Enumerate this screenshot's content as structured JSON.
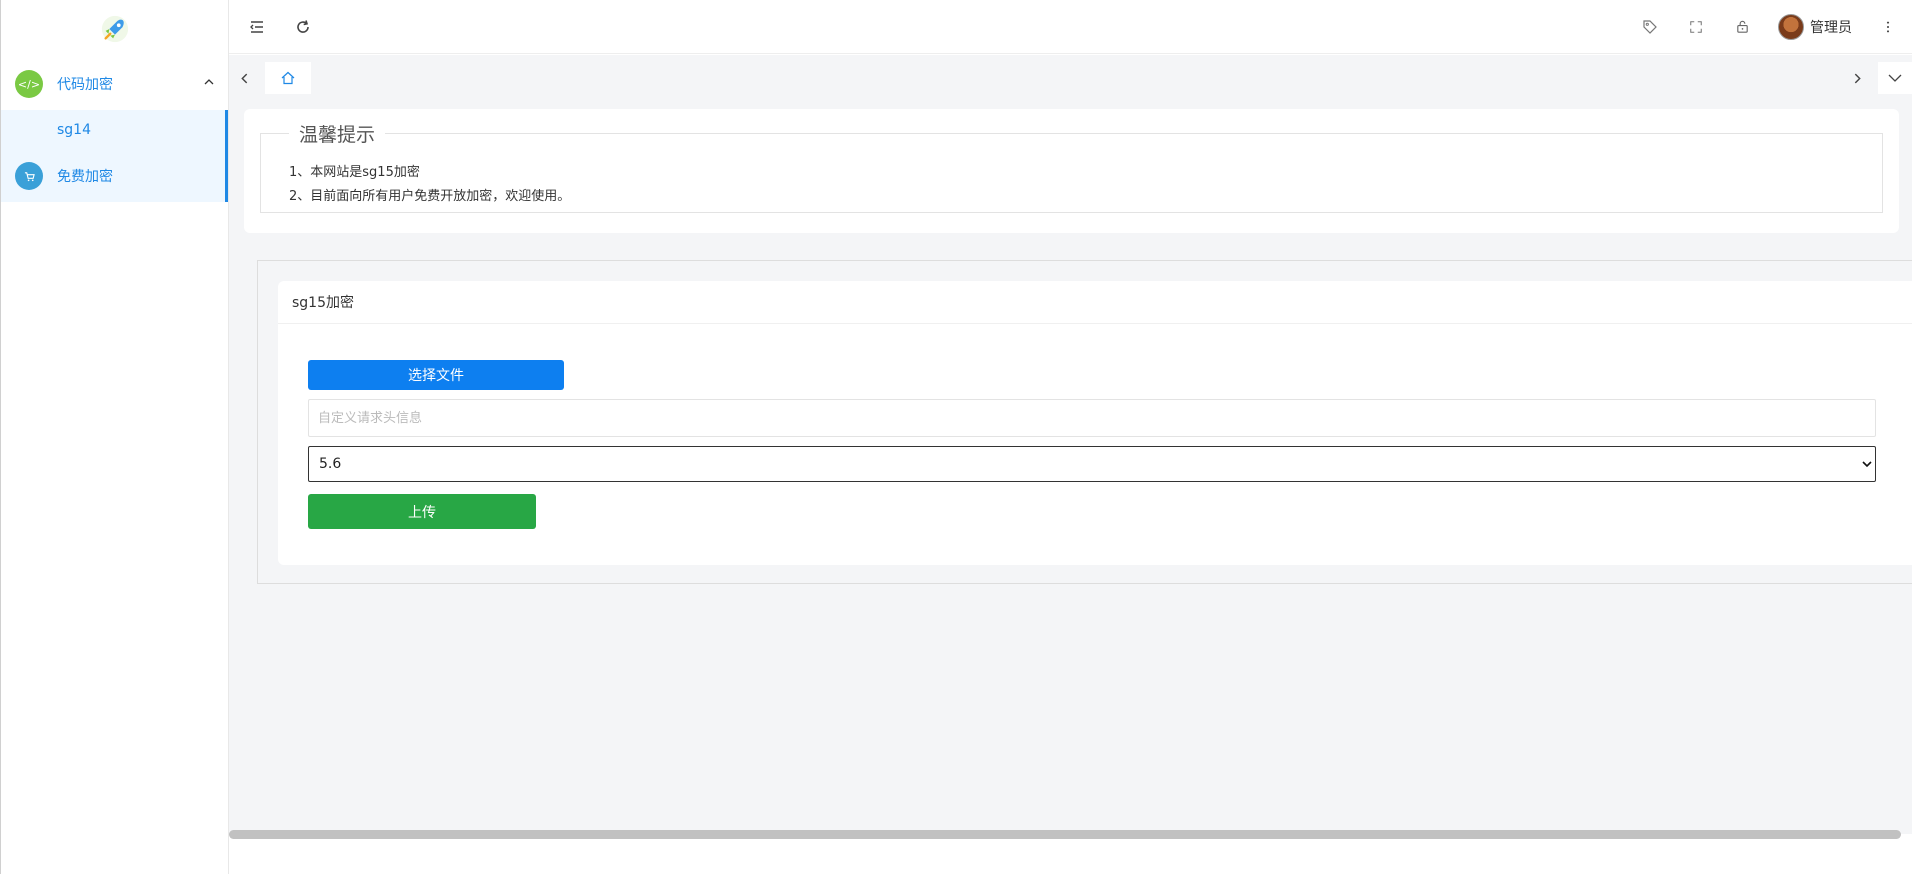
{
  "sidebar": {
    "items": [
      {
        "label": "代码加密",
        "icon": "code-icon",
        "color": "#7ac943",
        "expanded": true,
        "children": [
          {
            "label": "sg14"
          }
        ]
      },
      {
        "label": "免费加密",
        "icon": "cart-icon",
        "color": "#3aa0d8"
      }
    ]
  },
  "header": {
    "user_name": "管理员"
  },
  "notice": {
    "title": "温馨提示",
    "lines": [
      "1、本网站是sg15加密",
      "2、目前面向所有用户免费开放加密，欢迎使用。"
    ]
  },
  "form": {
    "panel_title": "sg15加密",
    "choose_file_label": "选择文件",
    "header_placeholder": "自定义请求头信息",
    "version_selected": "5.6",
    "upload_label": "上传"
  },
  "colors": {
    "accent": "#1e88e5",
    "primary_button": "#0d7ff0",
    "success_button": "#28a745"
  }
}
